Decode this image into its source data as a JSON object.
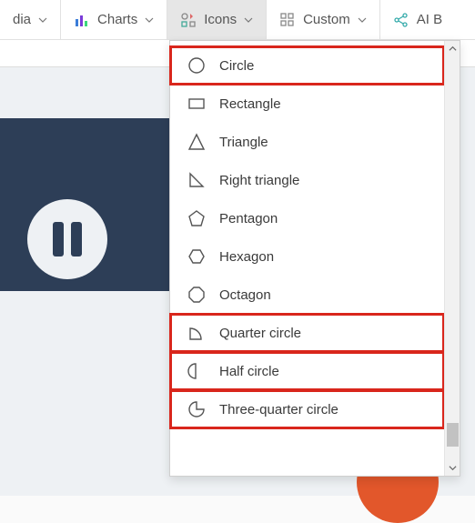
{
  "toolbar": {
    "media": {
      "label": "dia"
    },
    "charts": {
      "label": "Charts"
    },
    "icons": {
      "label": "Icons"
    },
    "custom": {
      "label": "Custom"
    },
    "ai": {
      "label": "AI B"
    }
  },
  "icons_menu": {
    "items": [
      {
        "label": "Circle",
        "highlight": true
      },
      {
        "label": "Rectangle",
        "highlight": false
      },
      {
        "label": "Triangle",
        "highlight": false
      },
      {
        "label": "Right triangle",
        "highlight": false
      },
      {
        "label": "Pentagon",
        "highlight": false
      },
      {
        "label": "Hexagon",
        "highlight": false
      },
      {
        "label": "Octagon",
        "highlight": false
      },
      {
        "label": "Quarter circle",
        "highlight": true
      },
      {
        "label": "Half circle",
        "highlight": true
      },
      {
        "label": "Three-quarter circle",
        "highlight": true
      }
    ]
  },
  "colors": {
    "slide_bg": "#2d3e57",
    "accent_orange": "#e2572b",
    "highlight_red": "#d9261c"
  }
}
